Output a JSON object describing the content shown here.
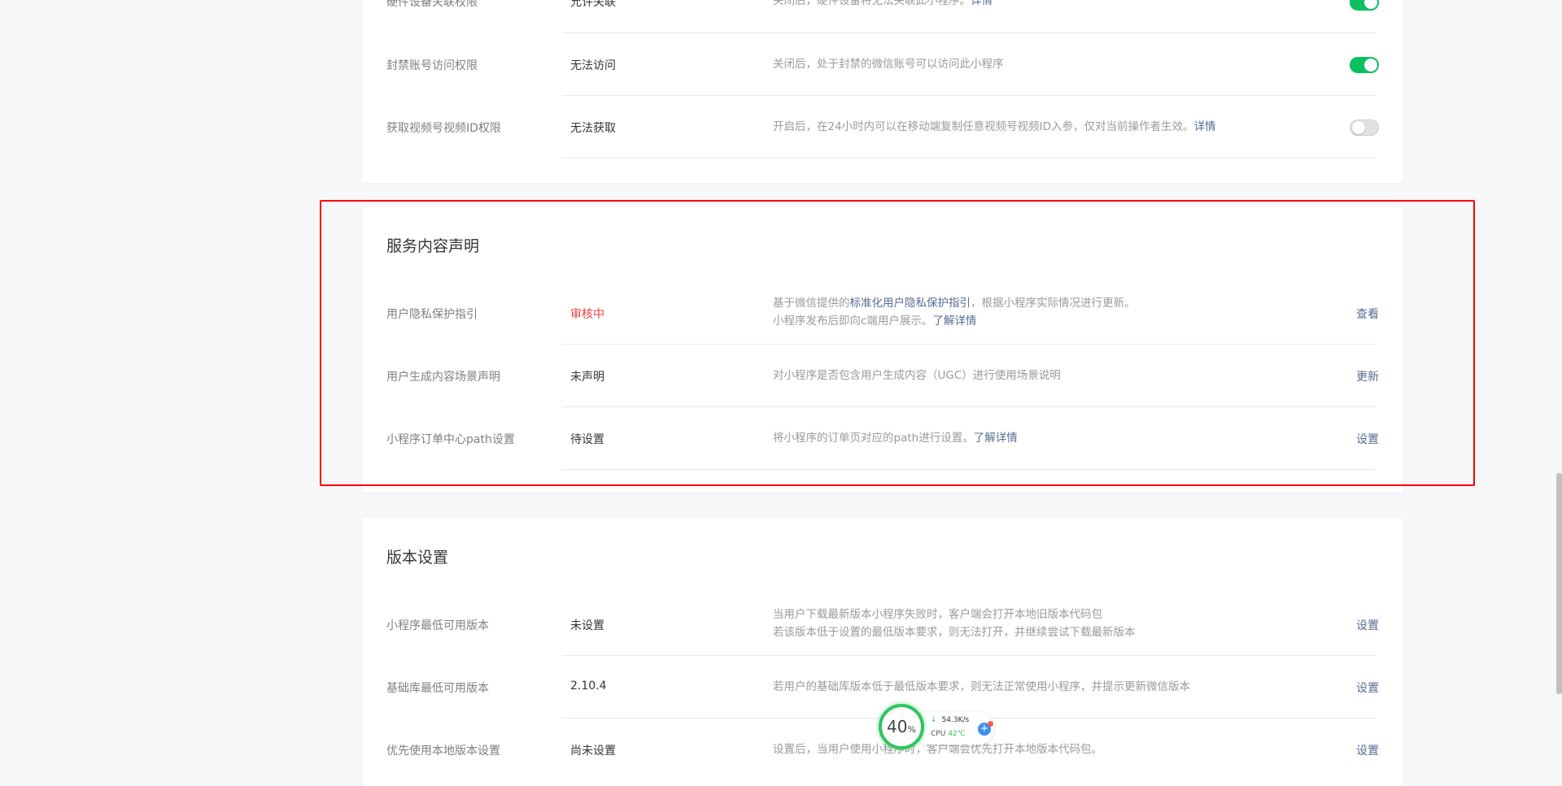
{
  "permissions": {
    "rows": [
      {
        "label": "硬件设备关联权限",
        "status": "允许关联",
        "desc": "关闭后，硬件设备将无法关联此小程序。",
        "desc_link": "详情",
        "toggle": "on"
      },
      {
        "label": "封禁账号访问权限",
        "status": "无法访问",
        "desc": "关闭后，处于封禁的微信账号可以访问此小程序",
        "toggle": "on"
      },
      {
        "label": "获取视频号视频ID权限",
        "status": "无法获取",
        "desc": "开启后，在24小时内可以在移动端复制任意视频号视频ID入参，仅对当前操作者生效。",
        "desc_link": "详情",
        "toggle": "off"
      }
    ]
  },
  "service_declaration": {
    "title": "服务内容声明",
    "rows": [
      {
        "label": "用户隐私保护指引",
        "status": "审核中",
        "desc_prefix": "基于微信提供的",
        "desc_link1": "标准化用户隐私保护指引",
        "desc_mid": "，根据小程序实际情况进行更新。",
        "desc_line2": "小程序发布后即向c端用户展示。",
        "desc_link2": "了解详情",
        "action": "查看"
      },
      {
        "label": "用户生成内容场景声明",
        "status": "未声明",
        "desc": "对小程序是否包含用户生成内容（UGC）进行使用场景说明",
        "action": "更新"
      },
      {
        "label": "小程序订单中心path设置",
        "status": "待设置",
        "desc": "将小程序的订单页对应的path进行设置。",
        "desc_link": "了解详情",
        "action": "设置"
      }
    ]
  },
  "version_settings": {
    "title": "版本设置",
    "rows": [
      {
        "label": "小程序最低可用版本",
        "status": "未设置",
        "desc_line1": "当用户下载最新版本小程序失败时，客户端会打开本地旧版本代码包",
        "desc_line2": "若该版本低于设置的最低版本要求，则无法打开，并继续尝试下载最新版本",
        "action": "设置"
      },
      {
        "label": "基础库最低可用版本",
        "status": "2.10.4",
        "desc": "若用户的基础库版本低于最低版本要求，则无法正常使用小程序，并提示更新微信版本",
        "action": "设置"
      },
      {
        "label": "优先使用本地版本设置",
        "status": "尚未设置",
        "desc": "设置后，当用户使用小程序时，客户端会优先打开本地版本代码包。",
        "action": "设置"
      }
    ]
  },
  "floating_monitor": {
    "percent": "40",
    "percent_unit": "%",
    "net_speed": "54.3K/s",
    "cpu_label": "CPU",
    "cpu_temp": "42℃",
    "add_symbol": "+"
  },
  "colors": {
    "toggle_on": "#07c160",
    "link": "#576b95",
    "pending": "#e64340",
    "highlight": "#ff0000"
  }
}
